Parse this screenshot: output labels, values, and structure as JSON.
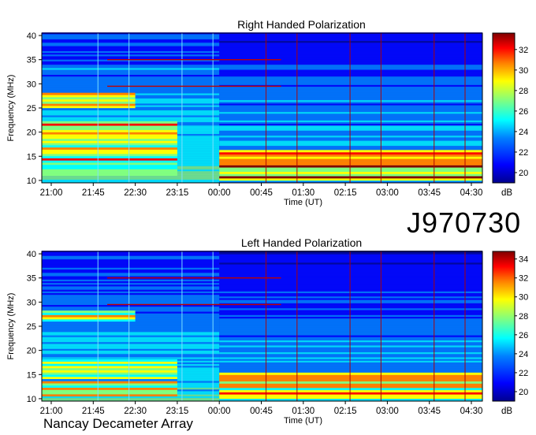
{
  "observation_id": "J970730",
  "observatory": "Nancay Decameter Array",
  "chart_data": [
    {
      "type": "heatmap",
      "title": "Right Handed Polarization",
      "xlabel": "Time (UT)",
      "ylabel": "Frequency (MHz)",
      "x_ticks": [
        "21:00",
        "21:45",
        "22:30",
        "23:15",
        "00:00",
        "00:45",
        "01:30",
        "02:15",
        "03:00",
        "03:45",
        "04:30"
      ],
      "y_ticks": [
        10,
        15,
        20,
        25,
        30,
        35,
        40
      ],
      "ylim": [
        9.5,
        40.5
      ],
      "colorbar": {
        "ticks": [
          20,
          22,
          24,
          26,
          28,
          30,
          32
        ],
        "range": [
          19,
          33.6
        ],
        "unit": "dB"
      },
      "colormap": [
        "#00008f",
        "#0000ff",
        "#0080ff",
        "#00ffff",
        "#80ff80",
        "#ffff00",
        "#ff8000",
        "#ff0000",
        "#800000"
      ],
      "emission_bands_mhz": [
        {
          "name": "band-early",
          "from": 11,
          "to": 22,
          "level": 30,
          "span": "21:00-23:15"
        },
        {
          "name": "band-mid",
          "from": 25,
          "to": 28,
          "level": 29,
          "span": "21:00-22:30"
        },
        {
          "name": "band-late",
          "from": 10,
          "to": 16,
          "level": 31,
          "span": "00:00-04:30"
        }
      ]
    },
    {
      "type": "heatmap",
      "title": "Left Handed Polarization",
      "xlabel": "Time (UT)",
      "ylabel": "Frequency (MHz)",
      "x_ticks": [
        "21:00",
        "21:45",
        "22:30",
        "23:15",
        "00:00",
        "00:45",
        "01:30",
        "02:15",
        "03:00",
        "03:45",
        "04:30"
      ],
      "y_ticks": [
        10,
        15,
        20,
        25,
        30,
        35,
        40
      ],
      "ylim": [
        9.5,
        40.5
      ],
      "colorbar": {
        "ticks": [
          20,
          22,
          24,
          26,
          28,
          30,
          32,
          34
        ],
        "range": [
          19,
          34.8
        ],
        "unit": "dB"
      },
      "colormap": [
        "#00008f",
        "#0000ff",
        "#0080ff",
        "#00ffff",
        "#80ff80",
        "#ffff00",
        "#ff8000",
        "#ff0000",
        "#800000"
      ],
      "emission_bands_mhz": [
        {
          "name": "band-early",
          "from": 10.5,
          "to": 18,
          "level": 30,
          "span": "21:00-23:15"
        },
        {
          "name": "band-mid",
          "from": 26,
          "to": 28,
          "level": 29,
          "span": "21:00-22:30"
        },
        {
          "name": "band-late",
          "from": 10,
          "to": 15,
          "level": 31,
          "span": "00:00-04:30"
        }
      ]
    }
  ]
}
